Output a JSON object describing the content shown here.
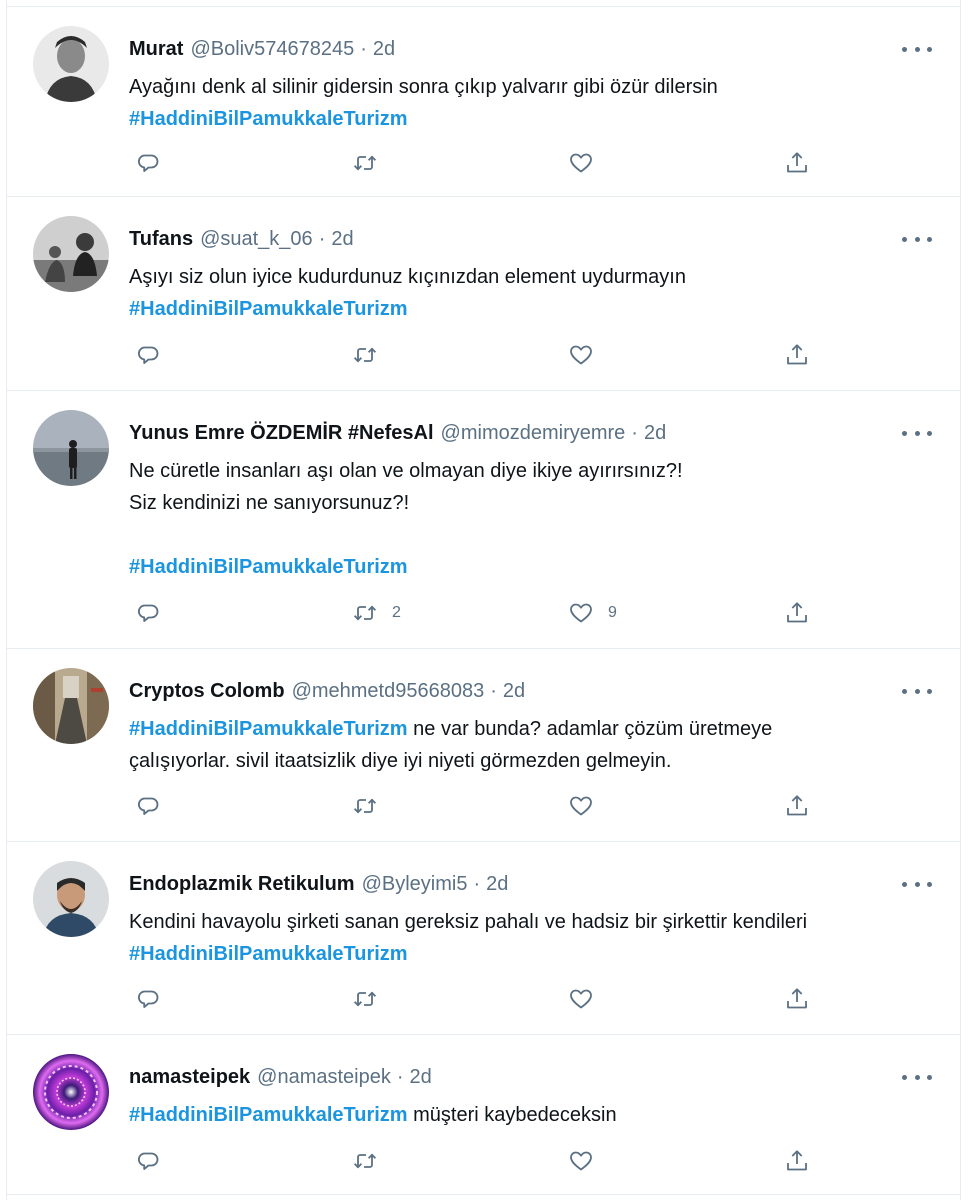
{
  "tweets": [
    {
      "name": "Murat",
      "handle": "@Boliv574678245",
      "time": "2d",
      "lines": [
        "Ayağını denk al silinir gidersin sonra çıkıp yalvarır gibi özür dilersin"
      ],
      "hashtag_line": "#HaddiniBilPamukkaleTurizm",
      "retweets": "",
      "likes": ""
    },
    {
      "name": "Tufans",
      "handle": "@suat_k_06",
      "time": "2d",
      "lines": [
        "Aşıyı siz olun iyice kudurdunuz kıçınızdan element uydurmayın"
      ],
      "hashtag_line": "#HaddiniBilPamukkaleTurizm",
      "retweets": "",
      "likes": ""
    },
    {
      "name": "Yunus Emre ÖZDEMİR #NefesAl",
      "handle": "@mimozdemiryemre",
      "time": "2d",
      "lines": [
        "Ne cüretle insanları aşı olan ve olmayan diye ikiye ayırırsınız?!",
        "Siz kendinizi ne sanıyorsunuz?!"
      ],
      "hashtag_line": "#HaddiniBilPamukkaleTurizm",
      "retweets": "2",
      "likes": "9"
    },
    {
      "name": "Cryptos Colomb",
      "handle": "@mehmetd95668083",
      "time": "2d",
      "inline_hashtag": "#HaddiniBilPamukkaleTurizm",
      "inline_rest": " ne var bunda? adamlar çözüm üretmeye",
      "line2": "çalışıyorlar. sivil itaatsizlik diye iyi niyeti görmezden gelmeyin.",
      "retweets": "",
      "likes": ""
    },
    {
      "name": "Endoplazmik Retikulum",
      "handle": "@Byleyimi5",
      "time": "2d",
      "lines": [
        "Kendini havayolu şirketi sanan gereksiz pahalı ve hadsiz bir şirkettir kendileri"
      ],
      "hashtag_line": "#HaddiniBilPamukkaleTurizm",
      "retweets": "",
      "likes": ""
    },
    {
      "name": "namasteipek",
      "handle": "@namasteipek",
      "time": "2d",
      "inline_hashtag": "#HaddiniBilPamukkaleTurizm",
      "inline_rest": " müşteri kaybedeceksin",
      "retweets": "",
      "likes": ""
    }
  ],
  "separator": "·",
  "icons": {
    "reply": "reply-icon",
    "retweet": "retweet-icon",
    "like": "heart-icon",
    "share": "share-icon",
    "more": "more-options-icon"
  },
  "colors": {
    "hashtag": "#1b95e0",
    "secondary_text": "#5b7083",
    "primary_text": "#0f1419",
    "divider": "#e6ecf0"
  }
}
